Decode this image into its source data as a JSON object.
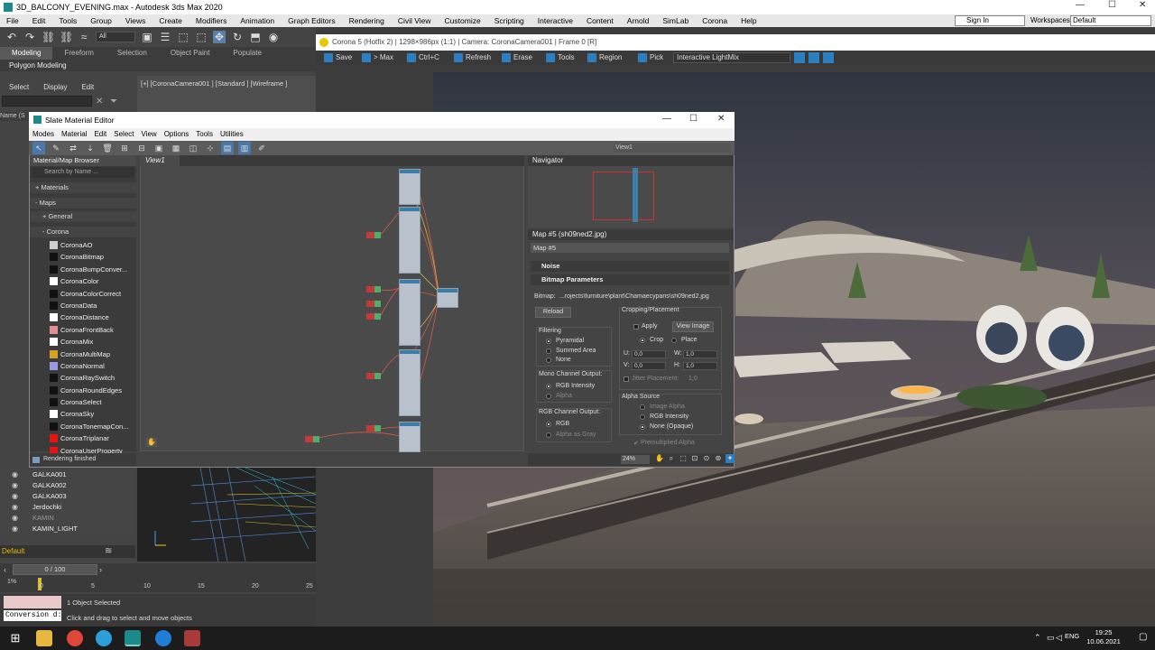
{
  "window": {
    "title": "3D_BALCONY_EVENING.max - Autodesk 3ds Max 2020",
    "min": "—",
    "max": "☐",
    "close": "✕"
  },
  "menubar": {
    "items": [
      "File",
      "Edit",
      "Tools",
      "Group",
      "Views",
      "Create",
      "Modifiers",
      "Animation",
      "Graph Editors",
      "Rendering",
      "Civil View",
      "Customize",
      "Scripting",
      "Interactive",
      "Content",
      "Arnold",
      "SimLab",
      "Corona",
      "Help"
    ],
    "signin": "Sign In",
    "workspaces_label": "Workspaces:",
    "workspaces_value": "Default"
  },
  "toolbar": {
    "selection_filter": "All"
  },
  "ribbon": {
    "tabs": [
      "Modeling",
      "Freeform",
      "Selection",
      "Object Paint",
      "Populate"
    ],
    "active": "Modeling",
    "sub": "Polygon Modeling"
  },
  "scene_explorer": {
    "menu": [
      "Select",
      "Display",
      "Edit"
    ],
    "name_header": "Name (S",
    "items": [
      "GALKA001",
      "GALKA002",
      "GALKA003",
      "Jerdochki",
      "KAMIN",
      "KAMIN_LIGHT"
    ],
    "layer": "Default"
  },
  "viewport": {
    "label": "[+] [CoronaCamera001 ] [Standard ] [Wireframe ]"
  },
  "timeline": {
    "frame": "0 / 100",
    "ticks": [
      "0",
      "5",
      "10",
      "15",
      "20",
      "25"
    ]
  },
  "status": {
    "selected": "1 Object Selected",
    "prompt": "Click and drag to select and move objects",
    "script": "Conversion d:"
  },
  "corona": {
    "title": "Corona 5 (Hotfix 2) | 1298×986px (1:1) | Camera: CoronaCamera001 | Frame 0 [R]",
    "buttons": [
      "Save",
      "> Max",
      "Ctrl+C",
      "Refresh",
      "Erase",
      "Tools",
      "Region",
      "Pick"
    ],
    "lightmix": "Interactive LightMix"
  },
  "sme": {
    "title": "Slate Material Editor",
    "menu": [
      "Modes",
      "Material",
      "Edit",
      "Select",
      "View",
      "Options",
      "Tools",
      "Utilities"
    ],
    "view_select": "View1",
    "view_tab": "View1",
    "browser": {
      "title": "Material/Map Browser",
      "search_placeholder": "Search by Name ...",
      "materials": "+ Materials",
      "maps": "- Maps",
      "general": "+ General",
      "corona": "- Corona",
      "items": [
        {
          "name": "CoronaAO",
          "color": "#cfcfcf"
        },
        {
          "name": "CoronaBitmap",
          "color": "#111111"
        },
        {
          "name": "CoronaBumpConver...",
          "color": "#111111"
        },
        {
          "name": "CoronaColor",
          "color": "#ffffff"
        },
        {
          "name": "CoronaColorCorrect",
          "color": "#111111"
        },
        {
          "name": "CoronaData",
          "color": "#111111"
        },
        {
          "name": "CoronaDistance",
          "color": "#ffffff"
        },
        {
          "name": "CoronaFrontBack",
          "color": "#e09090"
        },
        {
          "name": "CoronaMix",
          "color": "#ffffff"
        },
        {
          "name": "CoronaMultiMap",
          "color": "#d8a020"
        },
        {
          "name": "CoronaNormal",
          "color": "#9a9ae0"
        },
        {
          "name": "CoronaRaySwitch",
          "color": "#111111"
        },
        {
          "name": "CoronaRoundEdges",
          "color": "#111111"
        },
        {
          "name": "CoronaSelect",
          "color": "#111111"
        },
        {
          "name": "CoronaSky",
          "color": "#ffffff"
        },
        {
          "name": "CoronaTonemapCon...",
          "color": "#111111"
        },
        {
          "name": "CoronaTriplanar",
          "color": "#ee1111"
        },
        {
          "name": "CoronaUserProperty",
          "color": "#ee1111"
        }
      ],
      "status": "Rendering finished"
    },
    "navigator": "Navigator",
    "map": {
      "header": "Map #5 (sh09ned2.jpg)",
      "name": "Map #5",
      "noise": "Noise",
      "bitmap_params": "Bitmap Parameters",
      "bitmap_label": "Bitmap:",
      "bitmap_path": "...rojects\\furniture\\plant\\Chamaecyparis\\sh09ned2.jpg",
      "reload": "Reload",
      "cropping": "Cropping/Placement",
      "apply": "Apply",
      "view_image": "View Image",
      "crop": "Crop",
      "place": "Place",
      "u_label": "U:",
      "u_val": "0,0",
      "v_label": "V:",
      "v_val": "0,0",
      "w_label": "W:",
      "w_val": "1,0",
      "h_label": "H:",
      "h_val": "1,0",
      "jitter": "Jitter Placement:",
      "jitter_val": "1,0",
      "filtering": "Filtering",
      "pyramidal": "Pyramidal",
      "summed": "Summed Area",
      "none": "None",
      "mono": "Mono Channel Output:",
      "rgb_intensity": "RGB Intensity",
      "alpha": "Alpha",
      "rgb_out": "RGB Channel Output:",
      "rgb": "RGB",
      "alpha_gray": "Alpha as Gray",
      "alpha_source": "Alpha Source",
      "image_alpha": "Image Alpha",
      "rgb_intensity2": "RGB Intensity",
      "none_opaque": "None (Opaque)",
      "premult": "Premultiplied Alpha",
      "zoom": "24%"
    }
  },
  "taskbar": {
    "lang": "ENG",
    "time": "19:25",
    "date": "10.06.2021"
  }
}
